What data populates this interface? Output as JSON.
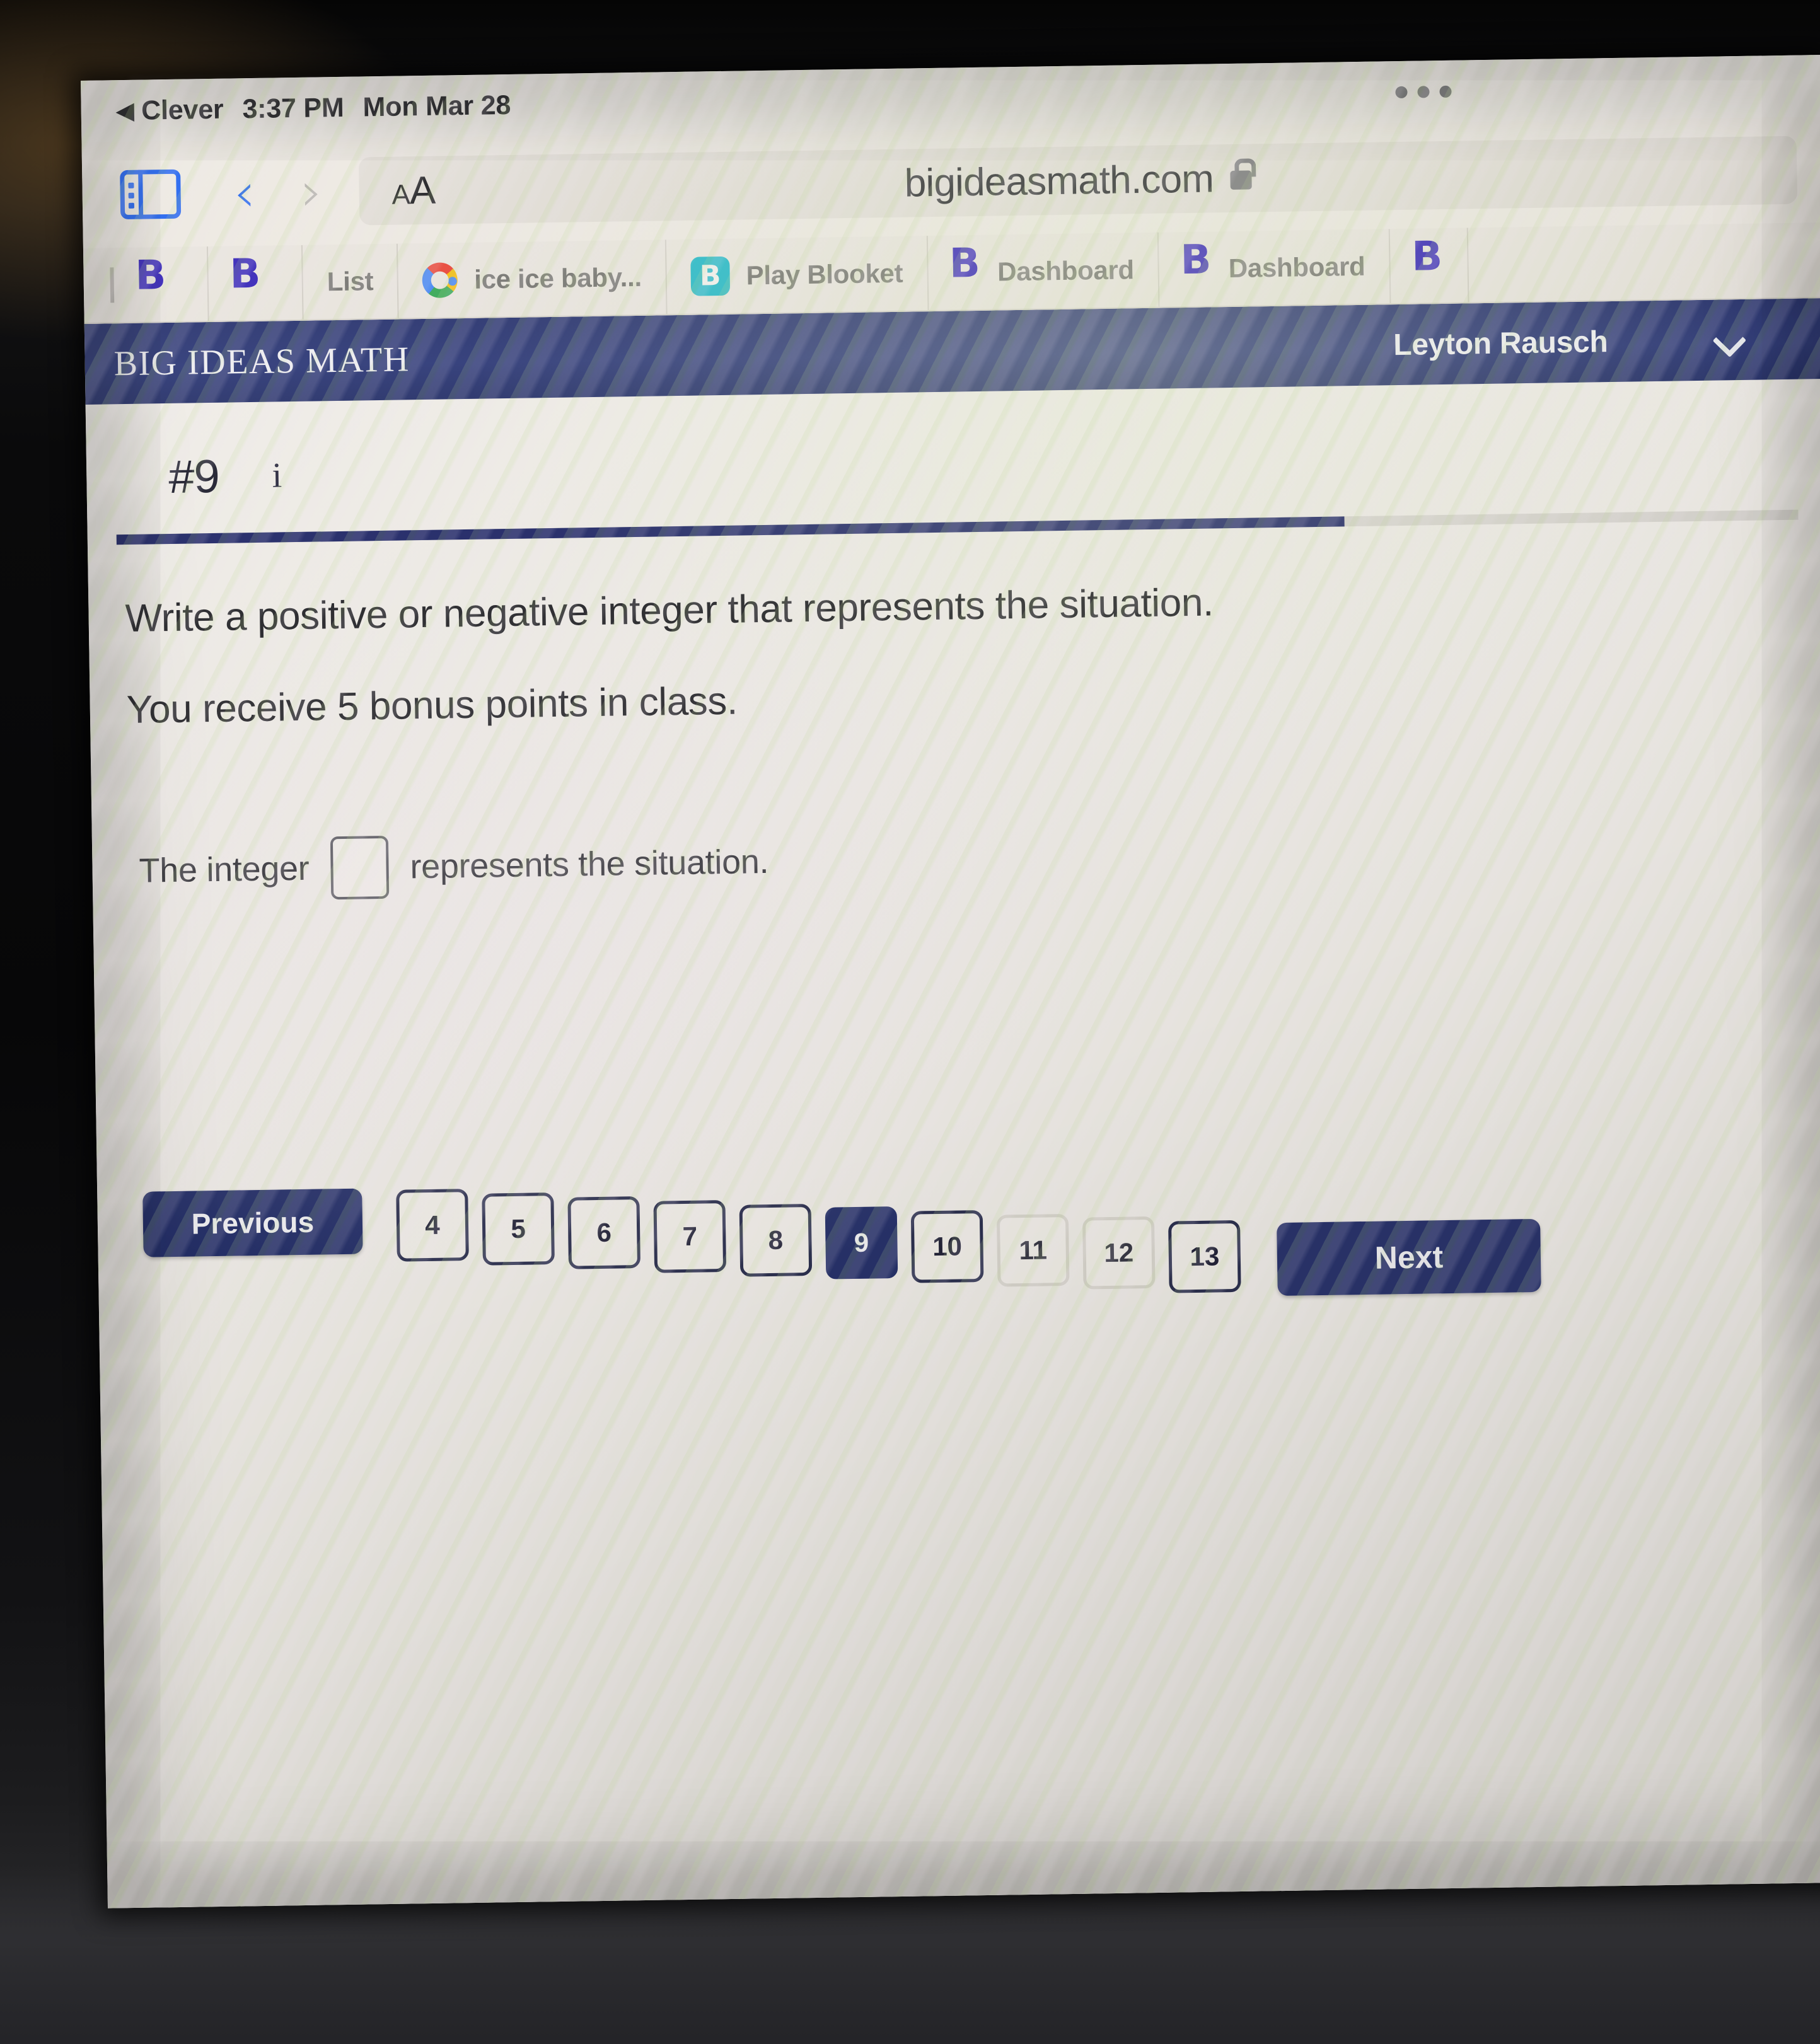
{
  "status_bar": {
    "back_app": "Clever",
    "back_arrow": "◀",
    "time": "3:37 PM",
    "date": "Mon Mar 28",
    "more_icon": "ellipsis-icon"
  },
  "safari": {
    "sidebar_icon": "sidebar-icon",
    "back_icon": "chevron-left-icon",
    "forward_icon": "chevron-right-icon",
    "aa_small": "A",
    "aa_large": "A",
    "url": "bigideasmath.com",
    "lock_icon": "lock-icon",
    "tabs": [
      {
        "label": "",
        "favicon": "bigideasmath-b-icon"
      },
      {
        "label": "",
        "favicon": "bigideasmath-b-icon"
      },
      {
        "label": "List",
        "favicon": "none"
      },
      {
        "label": "ice ice baby...",
        "favicon": "google-g-icon"
      },
      {
        "label": "Play Blooket",
        "favicon": "blooket-b-icon"
      },
      {
        "label": "Dashboard",
        "favicon": "bigideasmath-b-icon"
      },
      {
        "label": "Dashboard",
        "favicon": "bigideasmath-b-icon"
      }
    ]
  },
  "app_header": {
    "logo": "BIG IDEAS MATH",
    "user_name": "Leyton Rausch",
    "chevron_icon": "chevron-down-icon",
    "background_color": "#2a3676"
  },
  "question": {
    "number": "#9",
    "info_icon": "info-icon",
    "progress_percent": 73,
    "progress_fill_color": "#1e2566",
    "prompt": "Write a positive or negative integer that represents the situation.",
    "scenario": "You receive 5 bonus points in class.",
    "answer_prefix": "The integer",
    "answer_value": "",
    "answer_placeholder": "",
    "answer_suffix": "represents the situation."
  },
  "pagination": {
    "previous_label": "Previous",
    "next_label": "Next",
    "active_page": "9",
    "pages": [
      "4",
      "5",
      "6",
      "7",
      "8",
      "9",
      "10",
      "11",
      "12",
      "13"
    ],
    "accent_color": "#28336c"
  }
}
